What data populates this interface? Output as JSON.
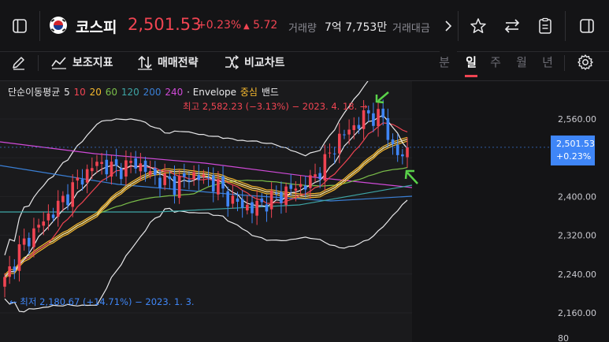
{
  "header": {
    "title": "코스피",
    "price": "2,501.53",
    "change_pct": "+0.23%",
    "change_abs": "5.72",
    "volume_label": "거래량",
    "volume_value": "7억 7,753만",
    "amount_label": "거래대금"
  },
  "toolbar": {
    "tools": [
      "보조지표",
      "매매전략",
      "비교차트"
    ],
    "periods": [
      "분",
      "일",
      "주",
      "월",
      "년"
    ],
    "active_period": "일"
  },
  "legend": {
    "name": "단순이동평균",
    "periods": [
      {
        "label": "5",
        "color": "#e8e8ea"
      },
      {
        "label": "10",
        "color": "#f04452"
      },
      {
        "label": "20",
        "color": "#f5b82e"
      },
      {
        "label": "60",
        "color": "#7bbf4a"
      },
      {
        "label": "120",
        "color": "#3ea6a6"
      },
      {
        "label": "200",
        "color": "#3a7fd5"
      },
      {
        "label": "240",
        "color": "#d04ad8"
      }
    ],
    "envelope_label": "· Envelope",
    "envelope_center": "중심",
    "envelope_band": "밴드"
  },
  "annotations": {
    "high": "최고 2,582.23 (−3.13%) − 2023. 4. 18.",
    "low": "최저 2,180.67 (+14.71%) − 2023. 1. 3."
  },
  "price_tag": {
    "price": "2,501.53",
    "pct": "+0.23%"
  },
  "colors": {
    "up": "#f04452",
    "down": "#3f86f7",
    "accent": "#f04452"
  },
  "chart_data": {
    "type": "candlestick",
    "y_axis_ticks": [
      2560,
      2480,
      2400,
      2320,
      2240,
      2160
    ],
    "y_axis_labels": [
      "2,560.00",
      "2,400.00",
      "2,320.00",
      "2,240.00",
      "2,160.00"
    ],
    "ylim": [
      2145,
      2620
    ],
    "bottom_label": "80",
    "last_price": 2501.53,
    "high": 2582.23,
    "low": 2180.67
  }
}
